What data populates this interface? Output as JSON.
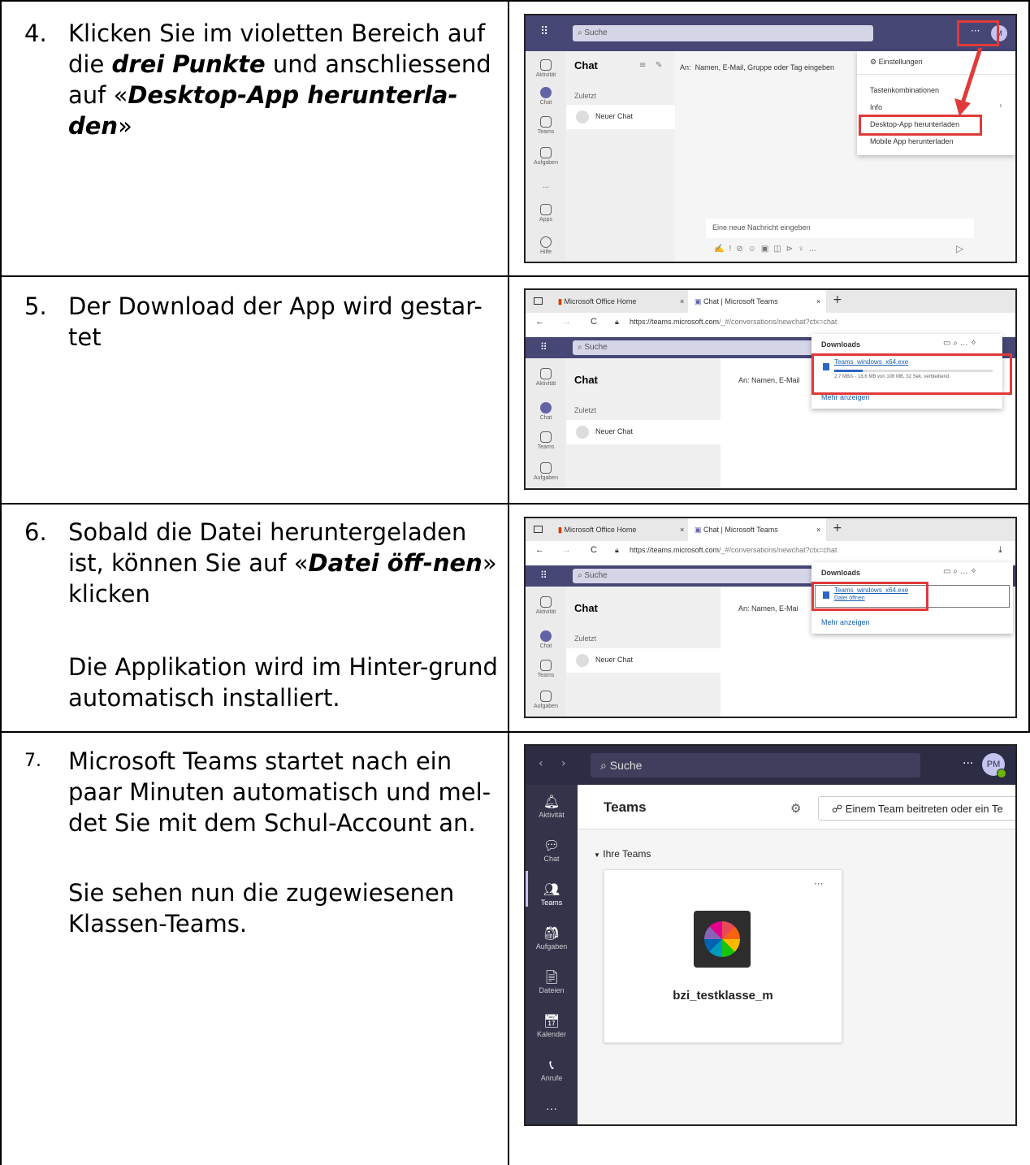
{
  "steps": [
    {
      "number": "4.",
      "text_1": "Klicken Sie im violetten Bereich auf die ",
      "text_2": "drei Punkte",
      "text_3": " und anschliessend auf «",
      "text_4": "Desktop-App herunterla-den",
      "text_5": "»"
    },
    {
      "number": "5.",
      "text_1": "Der Download der App wird gestar-tet"
    },
    {
      "number": "6.",
      "text_1": "Sobald die Datei heruntergeladen ist, können Sie auf «",
      "text_2": "Datei öff-nen",
      "text_3": "» klicken",
      "text_4": "Die Applikation wird im Hinter-grund automatisch installiert."
    },
    {
      "number": "7.",
      "text_1": "Microsoft Teams startet nach ein paar Minuten automatisch und mel-det Sie mit dem Schul-Account an.",
      "text_2": "Sie sehen nun die zugewiesenen Klassen-Teams."
    }
  ],
  "shot1": {
    "search": "Suche",
    "chat_title": "Chat",
    "to_label": "An:",
    "to_placeholder": "Namen, E-Mail, Gruppe oder Tag eingeben",
    "recent": "Zuletzt",
    "new_chat": "Neuer Chat",
    "compose": "Eine neue Nachricht eingeben",
    "rail": [
      "Aktivität",
      "Chat",
      "Teams",
      "Aufgaben",
      "...",
      "Apps",
      "Hilfe"
    ],
    "menu": [
      "Einstellungen",
      "Tastenkombinationen",
      "Info",
      "Desktop-App herunterladen",
      "Mobile App herunterladen"
    ],
    "dots": "···",
    "avatar": "M"
  },
  "shot2": {
    "tab1": "Microsoft Office Home",
    "tab2": "Chat | Microsoft Teams",
    "url_host": "https://teams.microsoft.com",
    "url_path": "/_#/conversations/newchat?ctx=chat",
    "search": "Suche",
    "chat_title": "Chat",
    "to_label": "An:",
    "to_placeholder": "Namen, E-Mail",
    "recent": "Zuletzt",
    "new_chat": "Neuer Chat",
    "downloads_title": "Downloads",
    "file_name": "Teams_windows_x64.exe",
    "progress": "2,7 MB/s - 18,6 MB von 106 MB, 32 Sek. verbleibend",
    "progress_fraction": 0.18,
    "more": "Mehr anzeigen",
    "rail": [
      "Aktivität",
      "Chat",
      "Teams",
      "Aufgaben"
    ]
  },
  "shot3": {
    "tab1": "Microsoft Office Home",
    "tab2": "Chat | Microsoft Teams",
    "url_host": "https://teams.microsoft.com",
    "url_path": "/_#/conversations/newchat?ctx=chat",
    "search": "Suche",
    "chat_title": "Chat",
    "to_label": "An:",
    "to_placeholder": "Namen, E-Mai",
    "recent": "Zuletzt",
    "new_chat": "Neuer Chat",
    "downloads_title": "Downloads",
    "file_name": "Teams_windows_x64.exe",
    "open_file": "Datei öffnen",
    "more": "Mehr anzeigen",
    "rail": [
      "Aktivität",
      "Chat",
      "Teams",
      "Aufgaben"
    ]
  },
  "shot4": {
    "search": "Suche",
    "avatar": "PM",
    "dots": "···",
    "title": "Teams",
    "join": "Einem Team beitreten oder ein Te",
    "your_teams": "Ihre Teams",
    "team_name": "bzi_testklasse_m",
    "card_dots": "···",
    "rail": [
      "Aktivität",
      "Chat",
      "Teams",
      "Aufgaben",
      "Dateien",
      "Kalender",
      "Anrufe",
      "···"
    ]
  },
  "colors": {
    "teams_purple": "#464775",
    "accent": "#6264a7",
    "highlight_red": "#e03a3a"
  }
}
